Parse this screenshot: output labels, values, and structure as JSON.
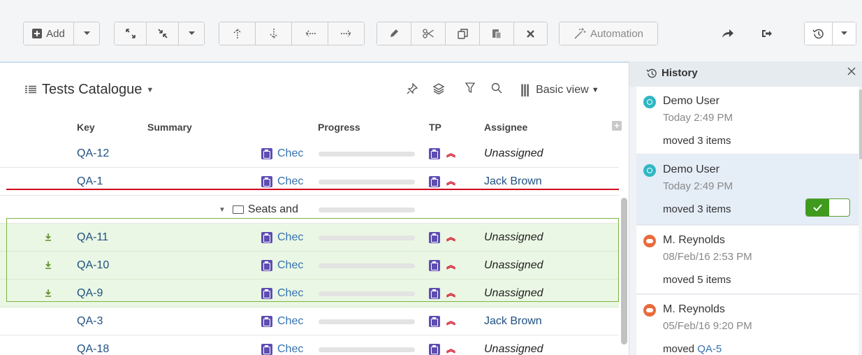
{
  "toolbar": {
    "add_label": "Add",
    "automation_label": "Automation",
    "icons": [
      "plus-square-icon",
      "caret-down-icon",
      "expand-icon",
      "collapse-icon",
      "move-up-icon",
      "move-down-icon",
      "outdent-icon",
      "indent-icon",
      "edit-icon",
      "cut-icon",
      "copy-icon",
      "paste-icon",
      "delete-icon",
      "magic-wand-icon",
      "share-icon",
      "sign-out-icon",
      "history-icon"
    ]
  },
  "catalogue": {
    "title": "Tests Catalogue",
    "view_label": "Basic view",
    "columns": {
      "key": "Key",
      "summary": "Summary",
      "progress": "Progress",
      "tp": "TP",
      "assignee": "Assignee"
    },
    "summary_text": "Chec",
    "folder_label": "Seats and",
    "rows": [
      {
        "key": "QA-12",
        "assignee": "Unassigned",
        "assigned": false,
        "moved": false
      },
      {
        "key": "QA-1",
        "assignee": "Jack Brown",
        "assigned": true,
        "moved": false
      },
      {
        "folder": true
      },
      {
        "key": "QA-11",
        "assignee": "Unassigned",
        "assigned": false,
        "moved": true
      },
      {
        "key": "QA-10",
        "assignee": "Unassigned",
        "assigned": false,
        "moved": true
      },
      {
        "key": "QA-9",
        "assignee": "Unassigned",
        "assigned": false,
        "moved": true
      },
      {
        "key": "QA-3",
        "assignee": "Jack Brown",
        "assigned": true,
        "moved": false
      },
      {
        "key": "QA-18",
        "assignee": "Unassigned",
        "assigned": false,
        "moved": false
      }
    ]
  },
  "history": {
    "title": "History",
    "items": [
      {
        "user": "Demo User",
        "time": "Today 2:49 PM",
        "action": "moved 3 items",
        "avatar": "demo",
        "selected": false
      },
      {
        "user": "Demo User",
        "time": "Today 2:49 PM",
        "action": "moved 3 items",
        "avatar": "demo",
        "selected": true,
        "toggle": true
      },
      {
        "user": "M. Reynolds",
        "time": "08/Feb/16 2:53 PM",
        "action": "moved 5 items",
        "avatar": "mr",
        "selected": false
      },
      {
        "user": "M. Reynolds",
        "time": "05/Feb/16 9:20 PM",
        "action_prefix": "moved",
        "action_link": "QA-5",
        "avatar": "mr",
        "selected": false
      }
    ]
  },
  "colors": {
    "link": "#205081",
    "priority": "#d0021b",
    "moved_bg": "#eaf7e4",
    "toggle_on": "#3f9a1d"
  }
}
